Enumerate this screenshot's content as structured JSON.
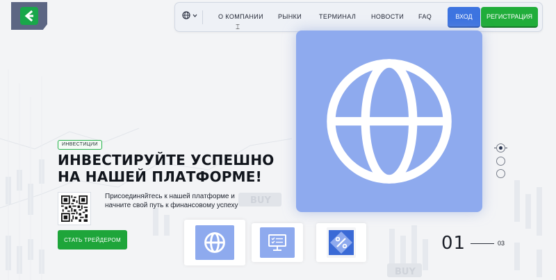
{
  "brand": {
    "logo_icon": "brand-arrow-logo",
    "colors": {
      "primary_green": "#20ad3a",
      "primary_blue": "#3d74e0",
      "card_blue": "#8eaaee"
    }
  },
  "nav": {
    "language_icon": "globe-icon",
    "links": [
      "О КОМПАНИИ",
      "РЫНКИ",
      "ТЕРМИНАЛ",
      "НОВОСТИ",
      "FAQ"
    ],
    "login_label": "ВХОД",
    "register_label": "РЕГИСТРАЦИЯ"
  },
  "hero": {
    "badge": "ИНВЕСТИЦИИ",
    "title_line1": "ИНВЕСТИРУЙТЕ УСПЕШНО",
    "title_line2": "НА НАШЕЙ ПЛАТФОРМЕ!",
    "subtitle_line1": "Присоединяйтесь к нашей платформе и",
    "subtitle_line2": "начните свой путь к финансовому успеху",
    "cta_label": "СТАТЬ ТРЕЙДЕРОМ",
    "main_icon": "globe-icon"
  },
  "background_labels": {
    "buy_1": "BUY",
    "buy_2": "BUY"
  },
  "slider": {
    "dots": 3,
    "active_dot": 1,
    "thumbnails": [
      "globe-icon",
      "monitor-checklist-icon",
      "percent-badge-icon"
    ],
    "current": "01",
    "total": "03"
  }
}
